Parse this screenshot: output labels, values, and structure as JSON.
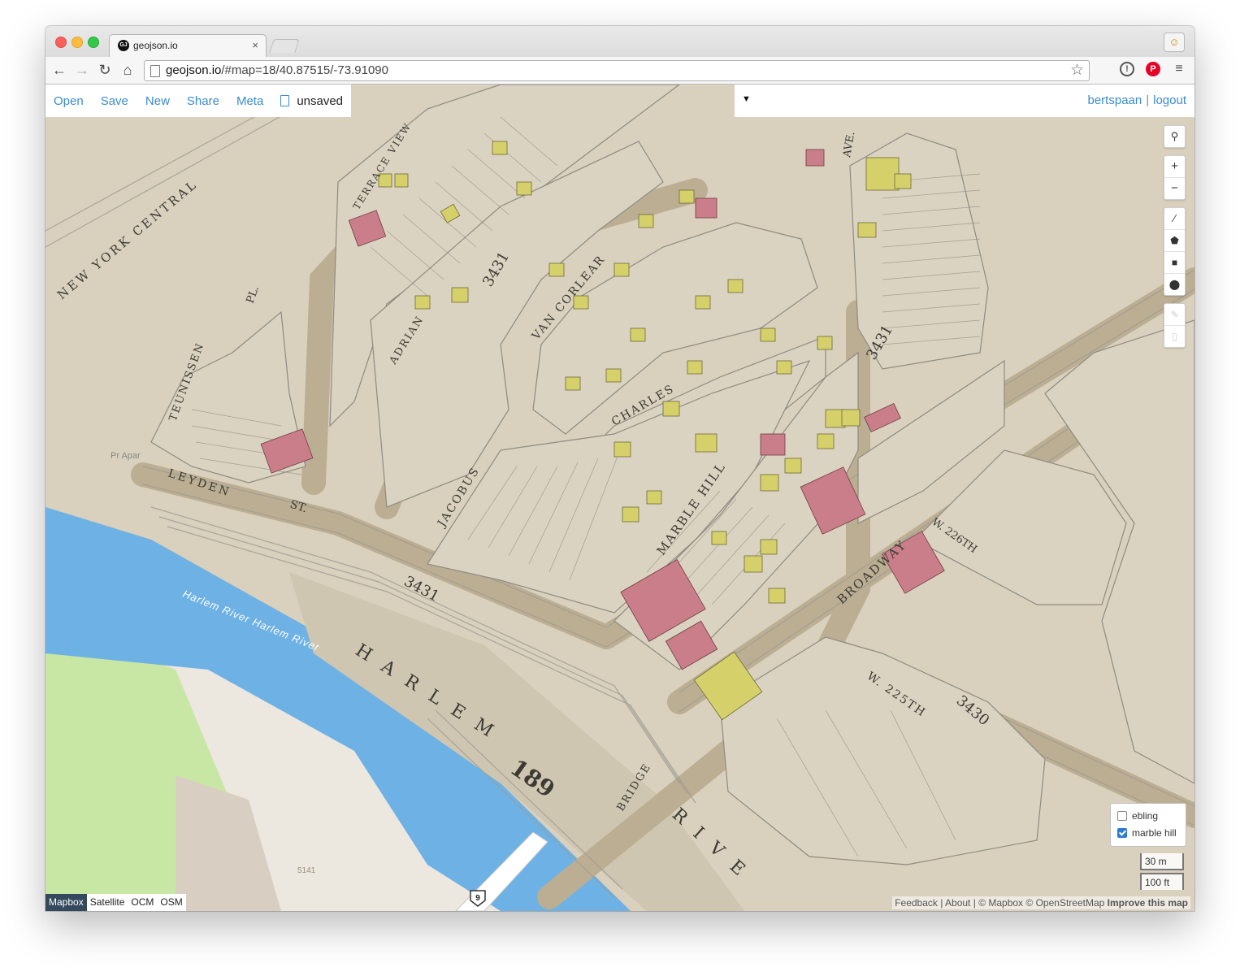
{
  "browser": {
    "tab_title": "geojson.io",
    "tab_favicon": "GJ",
    "url_host": "geojson.io",
    "url_path": "/#map=18/40.87515/-73.91090"
  },
  "app": {
    "menu": {
      "open": "Open",
      "save": "Save",
      "new": "New",
      "share": "Share",
      "meta": "Meta"
    },
    "document_name": "unsaved",
    "user": "bertspaan",
    "logout": "logout",
    "separator": "|",
    "colors": {
      "link": "#3a8bd0",
      "active_layer": "#34495e"
    }
  },
  "map_controls": {
    "search": "search-icon",
    "zoom_in": "+",
    "zoom_out": "−",
    "draw_tools": [
      "line-icon",
      "polygon-icon",
      "rectangle-icon",
      "marker-icon"
    ],
    "edit_tools": [
      "edit-icon",
      "trash-icon"
    ]
  },
  "overlays_legend": [
    {
      "label": "ebling",
      "checked": false
    },
    {
      "label": "marble hill",
      "checked": true
    }
  ],
  "scale": {
    "metric": "30 m",
    "imperial": "100 ft"
  },
  "base_layers": [
    {
      "label": "Mapbox",
      "active": true
    },
    {
      "label": "Satellite",
      "active": false
    },
    {
      "label": "OCM",
      "active": false
    },
    {
      "label": "OSM",
      "active": false
    }
  ],
  "attribution": {
    "feedback": "Feedback",
    "about": "About",
    "mapbox": "© Mapbox",
    "osm": "© OpenStreetMap",
    "improve": "Improve this map"
  },
  "map_labels": {
    "streets": [
      "NEW YORK CENTRAL",
      "TERRACE VIEW",
      "ADRIAN",
      "TEUNISSEN",
      "PL.",
      "LEYDEN",
      "ST.",
      "JACOBUS",
      "VAN CORLEAR",
      "CHARLES",
      "MARBLE HILL",
      "BROADWAY",
      "W. 225TH",
      "W. 226TH",
      "BRIDGE",
      "AVE.",
      "HARLEM",
      "RIVE"
    ],
    "numbers": [
      "3431",
      "3430",
      "189",
      "3431",
      "3431"
    ],
    "river": "Harlem River  Harlem River",
    "route": "9",
    "poi": "Pr Apar",
    "parcel": "5141"
  }
}
